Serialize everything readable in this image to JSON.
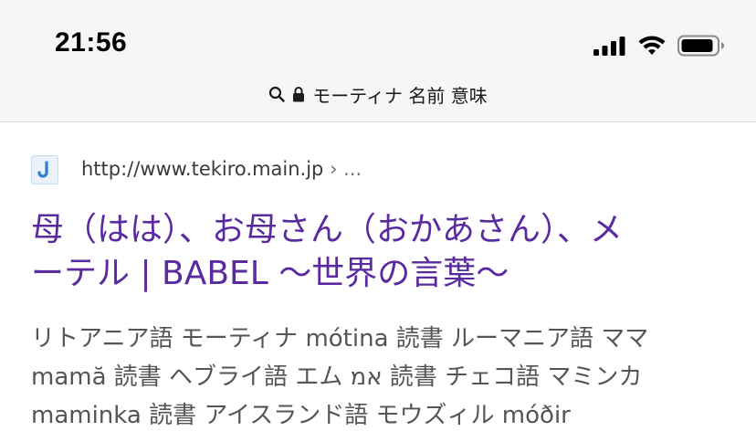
{
  "status_bar": {
    "time": "21:56"
  },
  "address_bar": {
    "query": "モーティナ 名前 意味"
  },
  "result": {
    "url": "http://www.tekiro.main.jp",
    "breadcrumb": " › ...",
    "title_line1": "母（はは）、お母さん（おかあさん）、メ",
    "title_line2": "ーテル | BABEL 〜世界の言葉〜",
    "snippet_line1": "リトアニア語 モーティナ mótina 読書 ルーマニア語 ママ",
    "snippet_line2": "mamă 読書 ヘブライ語 エム אמ 読書 チェコ語 マミンカ",
    "snippet_line3": "maminka 読書 アイスランド語 モウズィル móðir"
  }
}
